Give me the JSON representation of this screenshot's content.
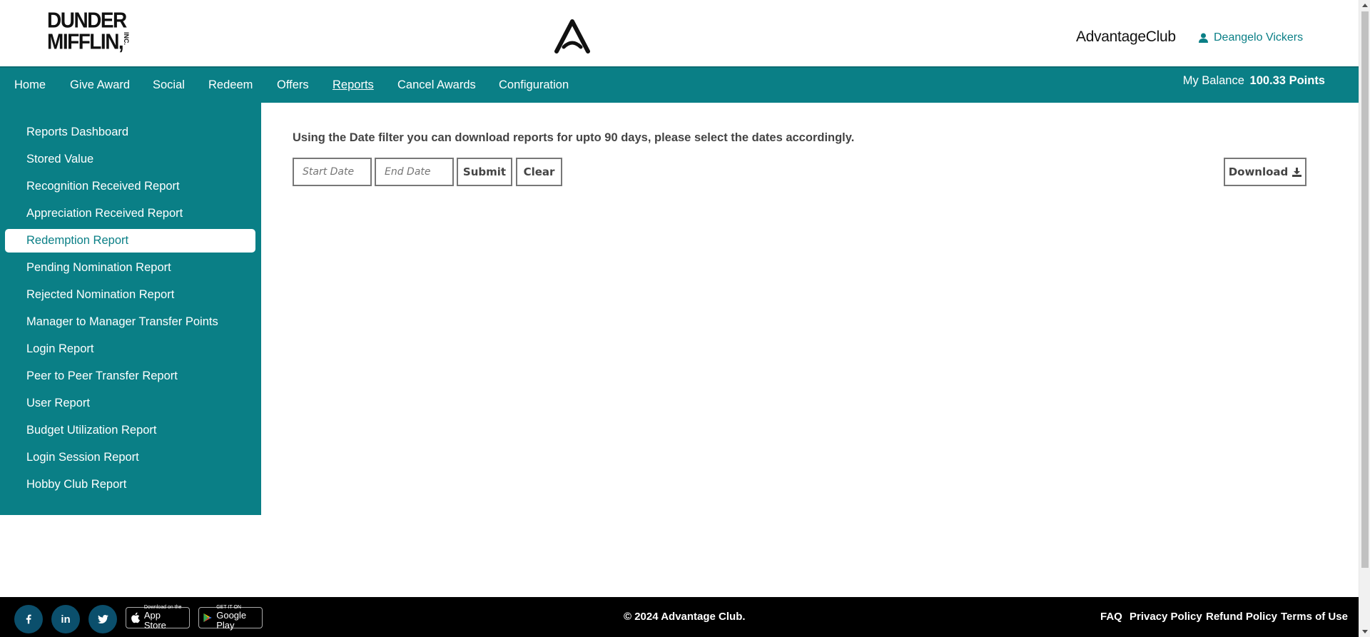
{
  "header": {
    "logo_line1": "DUNDER",
    "logo_line2": "MIFFLIN,",
    "logo_inc": "INC.",
    "club_name": "AdvantageClub",
    "user_name": "Deangelo Vickers",
    "user_icon": "user-icon"
  },
  "nav": {
    "items": [
      "Home",
      "Give Award",
      "Social",
      "Redeem",
      "Offers",
      "Reports",
      "Cancel Awards",
      "Configuration"
    ],
    "active": "Reports",
    "balance_label": "My Balance",
    "balance_value": "100.33 Points"
  },
  "sidebar": {
    "items": [
      "Reports Dashboard",
      "Stored Value",
      "Recognition Received Report",
      "Appreciation Received Report",
      "Redemption Report",
      "Pending Nomination Report",
      "Rejected Nomination Report",
      "Manager to Manager Transfer Points",
      "Login Report",
      "Peer to Peer Transfer Report",
      "User Report",
      "Budget Utilization Report",
      "Login Session Report",
      "Hobby Club Report"
    ],
    "active": "Redemption Report"
  },
  "main": {
    "info_text": "Using the Date filter you can download reports for upto 90 days, please select the dates accordingly.",
    "start_placeholder": "Start Date",
    "end_placeholder": "End Date",
    "submit_label": "Submit",
    "clear_label": "Clear",
    "download_label": "Download",
    "download_icon": "download-icon"
  },
  "footer": {
    "social": [
      "facebook-icon",
      "linkedin-icon",
      "twitter-icon"
    ],
    "app_store_small": "Download on the",
    "app_store_big": "App Store",
    "google_small": "GET IT ON",
    "google_big": "Google Play",
    "copyright": "© 2024 Advantage Club.",
    "links": [
      "FAQ",
      "Privacy Policy",
      "Refund Policy",
      "Terms of Use"
    ]
  },
  "colors": {
    "primary": "#0a7f86",
    "footer_bg": "#000000",
    "social_bg": "#0b4f6c"
  }
}
